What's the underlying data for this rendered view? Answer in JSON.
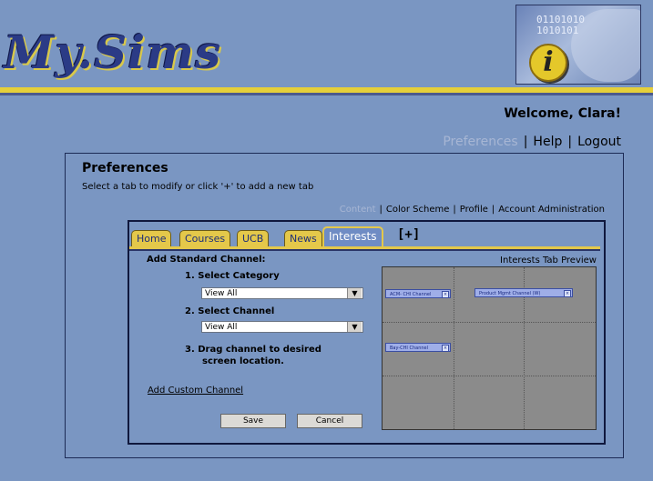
{
  "app": {
    "logo_text": "My.Sims"
  },
  "header": {
    "info_image_bits": [
      "01101010",
      "1010101"
    ],
    "welcome": "Welcome, Clara!",
    "links": [
      "Preferences",
      "Help",
      "Logout"
    ],
    "separator": "|"
  },
  "preferences": {
    "title": "Preferences",
    "instructions": "Select a tab to modify or click '+' to add a new tab",
    "sub_links": [
      "Content",
      "Color Scheme",
      "Profile",
      "Account Administration"
    ]
  },
  "tabs": [
    {
      "label": "Home"
    },
    {
      "label": "Courses"
    },
    {
      "label": "UCB"
    },
    {
      "label": "News"
    },
    {
      "label": "Interests",
      "active": true
    }
  ],
  "add_tab_label": "[+]",
  "standard_channel": {
    "title": "Add Standard Channel:",
    "step1": "1.  Select Category",
    "category_value": "View All",
    "step2": "2.  Select Channel",
    "channel_value": "View All",
    "step3_line1": "3.  Drag channel to desired",
    "step3_line2": "screen location.",
    "custom_link": "Add Custom Channel",
    "save": "Save",
    "cancel": "Cancel",
    "dropdown_icon": "▼"
  },
  "preview": {
    "title": "Interests Tab Preview",
    "channels": [
      {
        "label": "ACM- CHI Channel"
      },
      {
        "label": "Product Mgmt Channel  (W)"
      },
      {
        "label": "Bay-CHI Channel"
      }
    ],
    "close_glyph": "×"
  },
  "colors": {
    "background": "#7a96c2",
    "accent_yellow": "#e4c84a",
    "logo_blue": "#2b3b86"
  }
}
